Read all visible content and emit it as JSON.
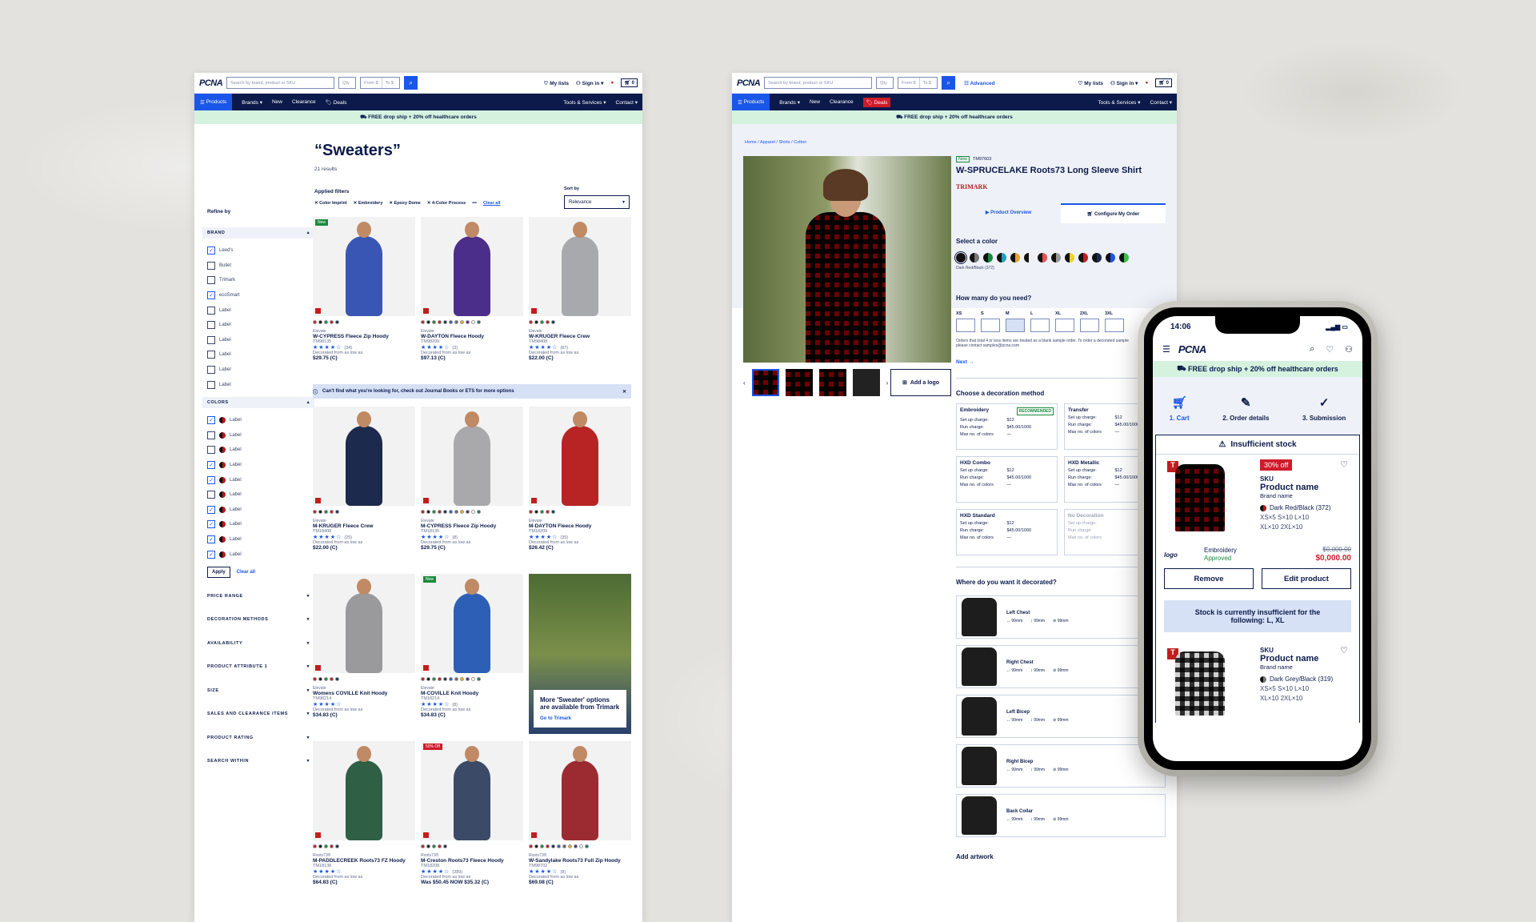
{
  "header": {
    "logo": "PCNA",
    "search_ph": "Search by brand, product or SKU",
    "qty": "Qty",
    "from": "From $",
    "to": "To $",
    "my_lists": "My lists",
    "sign_in": "Sign in",
    "cart": "0",
    "advanced": "Advanced"
  },
  "nav": {
    "products": "Products",
    "brands": "Brands",
    "new": "New",
    "clearance": "Clearance",
    "deals": "Deals",
    "tools": "Tools & Services",
    "contact": "Contact"
  },
  "promo": "FREE drop ship + 20% off healthcare orders",
  "search": {
    "title": "“Sweaters”",
    "count": "21 results",
    "applied": "Applied filters",
    "filters": [
      "Color Imprint",
      "Embroidery",
      "Epoxy Dome",
      "4-Color Process"
    ],
    "clear_all": "Clear all",
    "sort_by": "Sort by",
    "sort_val": "Relevance",
    "refine": "Refine by",
    "brand_hd": "BRAND",
    "brands": [
      "Leed's",
      "Bullet",
      "Trimark",
      "ecoSmart",
      "Label",
      "Label",
      "Label",
      "Label",
      "Label",
      "Label"
    ],
    "colors_hd": "COLORS",
    "colors": [
      "Label",
      "Label",
      "Label",
      "Label",
      "Label",
      "Label",
      "Label",
      "Label",
      "Label",
      "Label"
    ],
    "apply": "Apply",
    "clear": "Clear all",
    "facets": [
      "PRICE RANGE",
      "DECORATION METHODS",
      "AVAILABILITY",
      "PRODUCT ATTRIBUTE 1",
      "SIZE",
      "SALES AND CLEARANCE ITEMS",
      "PRODUCT RATING",
      "SEARCH WITHIN"
    ],
    "info": "Can't find what you're looking for, check out Journal Books or ETS for more options",
    "promo_card": {
      "title": "More 'Sweater' options are available from Trimark",
      "link": "Go to Trimark"
    },
    "products": [
      {
        "brand": "Elevate",
        "name": "W-CYPRESS Fleece Zip Hoody",
        "sku": "TM98135",
        "dec": "Decorated from as low as",
        "reviews": "(34)",
        "price": "$29.75 (C)",
        "color": "#3a56b5",
        "badge": "New"
      },
      {
        "brand": "Elevate",
        "name": "W-DAYTON Fleece Hoody",
        "sku": "TM98209",
        "dec": "Decorated from as low as",
        "reviews": "(3)",
        "price": "$97.13 (C)",
        "color": "#4b2e8a"
      },
      {
        "brand": "Elevate",
        "name": "W-KRUGER Fleece Crew",
        "sku": "TM98408",
        "dec": "Decorated from as low as",
        "reviews": "(87)",
        "price": "$22.00 (C)",
        "color": "#a7a9ad"
      },
      {
        "brand": "Elevate",
        "name": "M-KRUGER Fleece Crew",
        "sku": "TM18408",
        "dec": "Decorated from as low as",
        "reviews": "(25)",
        "price": "$22.00 (C)",
        "color": "#1c2a4d"
      },
      {
        "brand": "Elevate",
        "name": "M-CYPRESS Fleece Zip Hoody",
        "sku": "TM18135",
        "dec": "Decorated from as low as",
        "reviews": "(8)",
        "price": "$29.75 (C)",
        "color": "#a9a9ab"
      },
      {
        "brand": "Elevate",
        "name": "M-DAYTON Fleece Hoody",
        "sku": "TM18209",
        "dec": "Decorated from as low as",
        "reviews": "(35)",
        "price": "$26.42 (C)",
        "color": "#b82424"
      },
      {
        "brand": "Elevate",
        "name": "Womens COVILLE Knit Hoody",
        "sku": "TM98214",
        "dec": "Decorated from as low as",
        "reviews": "",
        "price": "$34.83 (C)",
        "color": "#9a9a9c"
      },
      {
        "brand": "Elevate",
        "name": "M-COVILLE Knit Hoody",
        "sku": "TM18214",
        "dec": "Decorated from as low as",
        "reviews": "(8)",
        "price": "$34.83 (C)",
        "color": "#2c5fb5",
        "badge": "New"
      },
      {
        "brand": "Roots73®",
        "name": "M-PADDLECREEK Roots73 FZ Hoody",
        "sku": "TM18138",
        "dec": "Decorated from as low as",
        "reviews": "",
        "price": "$64.83 (C)",
        "color": "#2f5f44"
      },
      {
        "brand": "Roots73®",
        "name": "M-Creston Roots73 Fleece Hoody",
        "sku": "TM18208",
        "dec": "Decorated from as low as",
        "reviews": "(389)",
        "price": "Was $50.45 NOW $35.32 (C)",
        "color": "#3b4a66",
        "badge": "50% Off"
      },
      {
        "brand": "Roots73®",
        "name": "W-Sandylake Roots73 Full Zip Hoody",
        "sku": "TM98702",
        "dec": "Decorated from as low as",
        "reviews": "(8)",
        "price": "$69.08 (C)",
        "color": "#9b2b30"
      }
    ]
  },
  "pdp": {
    "crumbs": "Home  /  Apparel  /  Shirts  /  Cotton",
    "new": "New",
    "sku": "TM97603",
    "name": "W-SPRUCELAKE Roots73 Long Sleeve Shirt",
    "brand": "TRIMARK",
    "tab1": "Product Overview",
    "tab2": "Configure My Order",
    "select_color": "Select a color",
    "color_name": "Dark Red/Black (372)",
    "how_many": "How many do you need?",
    "sizes": [
      "XS",
      "S",
      "M",
      "L",
      "XL",
      "2XL",
      "3XL"
    ],
    "note": "Orders that total 4 or less items are treated as a blank sample order. To order a decorated sample please contact samples@pcna.com",
    "next": "Next →",
    "add_logo": "Add a logo",
    "deco_title": "Choose a decoration method",
    "deco": [
      {
        "name": "Embroidery",
        "rec": "RECOMMENDED",
        "setup": "$12",
        "run": "$45.00/1000",
        "max": "—"
      },
      {
        "name": "Transfer",
        "setup": "$12",
        "run": "$45.00/1000",
        "max": "—"
      },
      {
        "name": "HXD Combo",
        "setup": "$12",
        "run": "$45.00/1000",
        "max": "—"
      },
      {
        "name": "HXD Metallic",
        "setup": "$12",
        "run": "$45.00/1000",
        "max": "—"
      },
      {
        "name": "HXD Standard",
        "setup": "$12",
        "run": "$45.00/1000",
        "max": "—"
      },
      {
        "name": "No Decoration",
        "setup": "",
        "run": "",
        "max": ""
      }
    ],
    "labels": {
      "setup": "Set up charge:",
      "run": "Run charge:",
      "max": "Max no. of colors"
    },
    "where": "Where do you want it decorated?",
    "locations": [
      "Left Chest",
      "Right Chest",
      "Left Bicep",
      "Right Bicep",
      "Back Collar"
    ],
    "dim": "99mm",
    "add_artwork": "Add artwork"
  },
  "mobile": {
    "time": "14:06",
    "steps": [
      "1. Cart",
      "2. Order details",
      "3. Submission"
    ],
    "warn": "Insufficient stock",
    "items": [
      {
        "off": "30% off",
        "sku": "SKU",
        "name": "Product name",
        "brand": "Brand name",
        "color": "Dark Red/Black (372)",
        "sizes1": "XS×5   S×10   L×10",
        "sizes2": "XL×10   2XL×10",
        "logo": "logo",
        "deco": "Embroidery",
        "status": "Approved",
        "was": "$0,000.00",
        "now": "$0,000.00"
      },
      {
        "sku": "SKU",
        "name": "Product name",
        "brand": "Brand name",
        "color": "Dark Grey/Black (319)",
        "sizes1": "XS×5   S×10   L×10",
        "sizes2": "XL×10   2XL×10"
      }
    ],
    "remove": "Remove",
    "edit": "Edit product",
    "stock_msg": "Stock is currently insufficient for the following: L, XL"
  }
}
